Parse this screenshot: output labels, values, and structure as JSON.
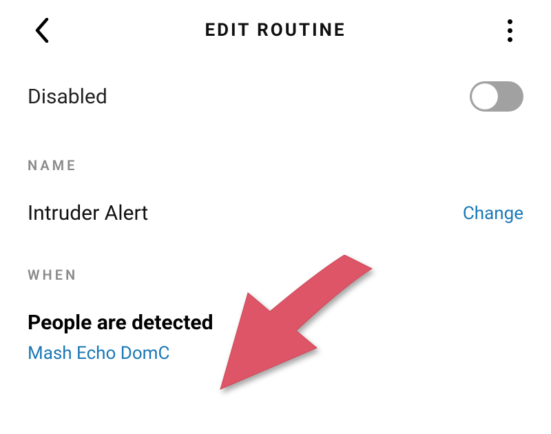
{
  "header": {
    "title": "EDIT ROUTINE"
  },
  "status": {
    "label": "Disabled"
  },
  "sections": {
    "name_label": "NAME",
    "when_label": "WHEN"
  },
  "routine": {
    "name": "Intruder Alert",
    "change_label": "Change"
  },
  "when": {
    "trigger_text": "People are detected",
    "device_name": "Mash Echo DomC"
  }
}
